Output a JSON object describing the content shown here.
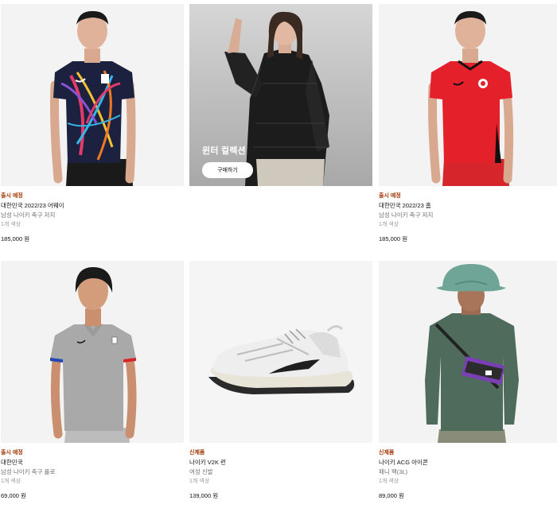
{
  "products": [
    {
      "badge": "출시 예정",
      "name": "대한민국 2022/23 어웨이",
      "subtitle": "남성 나이키 축구 저지",
      "colors": "1개 색상",
      "price": "185,000 원",
      "icon": "korea-away-jersey-photo"
    },
    {
      "promo": true,
      "title": "윈터 컬렉션",
      "button": "구매하기",
      "icon": "winter-jacket-model-photo"
    },
    {
      "badge": "출시 예정",
      "name": "대한민국 2022/23 홈",
      "subtitle": "남성 나이키 축구 저지",
      "colors": "1개 색상",
      "price": "185,000 원",
      "icon": "korea-home-jersey-photo"
    },
    {
      "badge": "출시 예정",
      "name": "대한민국",
      "subtitle": "남성 나이키 축구 폴로",
      "colors": "1개 색상",
      "price": "69,000 원",
      "icon": "korea-polo-photo"
    },
    {
      "badge": "신제품",
      "name": "나이키 V2K 런",
      "subtitle": "여성 신발",
      "colors": "1개 색상",
      "price": "139,000 원",
      "icon": "v2k-run-shoe-photo"
    },
    {
      "badge": "신제품",
      "name": "나이키 ACG 아이콘",
      "subtitle": "패니 팩(3L)",
      "colors": "1개 색상",
      "price": "89,000 원",
      "icon": "acg-fanny-pack-photo"
    }
  ],
  "colors": {
    "badge": "#9e3500",
    "home_red": "#e4202a",
    "muted": "#707072"
  }
}
